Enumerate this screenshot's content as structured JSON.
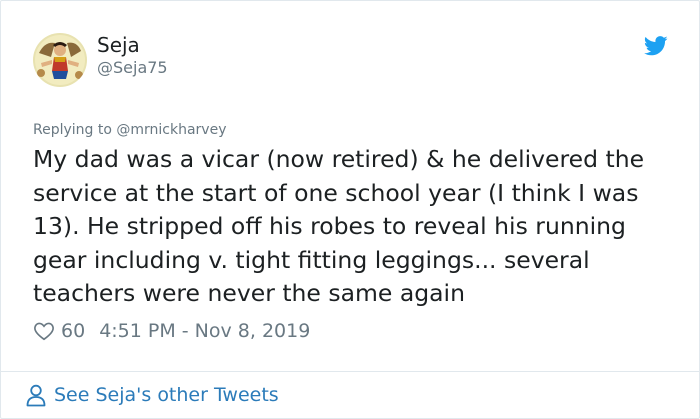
{
  "user": {
    "name": "Seja",
    "handle": "@Seja75"
  },
  "reply": {
    "text": "Replying to @mrnickharvey"
  },
  "tweet": {
    "lines": [
      "My dad was a vicar (now retired) & he delivered the",
      "service at the start of one school year (I think I was",
      "13). He stripped off his robes to reveal his running",
      "gear including v. tight fitting leggings... several",
      "teachers were never the same again"
    ]
  },
  "meta": {
    "likes": "60",
    "timestamp": "4:51 PM - Nov 8, 2019"
  },
  "footer": {
    "see_more": "See Seja's other Tweets"
  },
  "colors": {
    "twitter_blue": "#1da1f2",
    "link_blue": "#2b7bb9",
    "muted_gray": "#697882",
    "text": "#1c2022"
  },
  "icons": {
    "brand": "twitter-bird-icon",
    "like": "heart-icon",
    "profile": "person-icon"
  }
}
